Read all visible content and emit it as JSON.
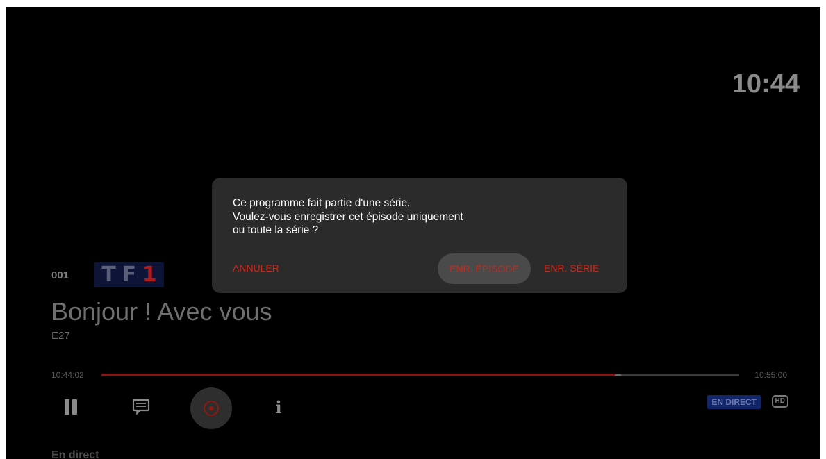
{
  "header": {
    "clock": "10:44"
  },
  "channel": {
    "number": "001",
    "logo_letters": [
      "T",
      "F",
      "1"
    ]
  },
  "program": {
    "title": "Bonjour ! Avec vous",
    "episode": "E27"
  },
  "playback": {
    "start_time": "10:44:02",
    "end_time": "10:55:00",
    "progress_fraction": 0.805,
    "buffer_fraction": 0.815
  },
  "controls": {
    "pause_icon": "pause-icon",
    "subtitles_icon": "subtitles-icon",
    "record_icon": "record-icon",
    "info_icon": "info-icon",
    "info_glyph": "i"
  },
  "badges": {
    "live": "EN DIRECT",
    "hd": "HD"
  },
  "section": {
    "label": "En direct"
  },
  "dialog": {
    "message_lines": [
      "Ce programme fait partie d'une série.",
      "Voulez-vous enregistrer cet épisode uniquement",
      "ou toute la série ?"
    ],
    "cancel_label": "ANNULER",
    "episode_label": "ENR. ÉPISODE",
    "series_label": "ENR. SÉRIE"
  },
  "colors": {
    "accent_red": "#c82a1d",
    "dialog_bg": "#2b2b2b",
    "live_badge_bg": "#10256a"
  }
}
